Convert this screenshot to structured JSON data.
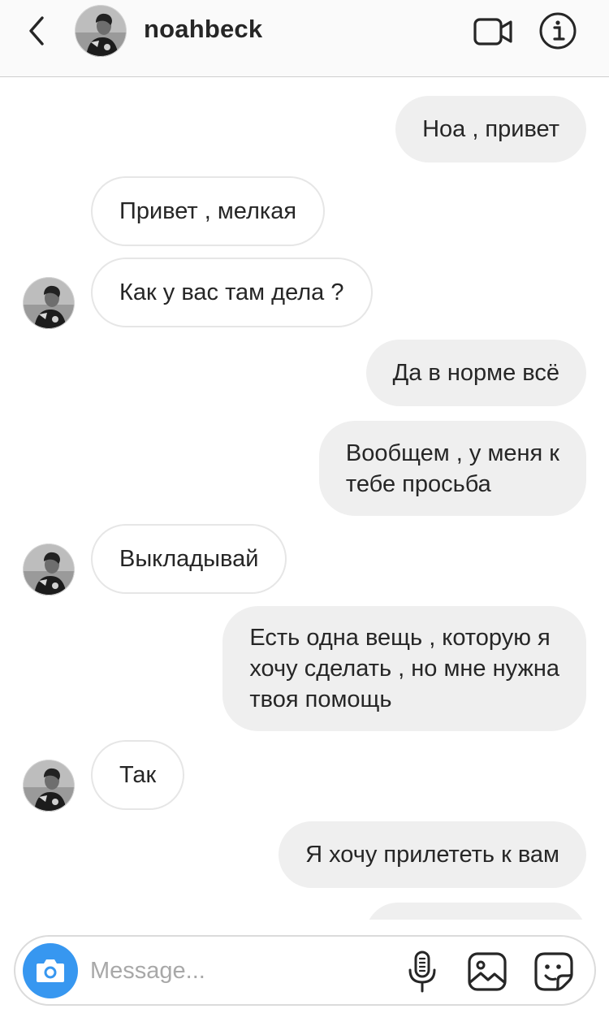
{
  "header": {
    "username": "noahbeck",
    "back_icon": "chevron-left-icon",
    "video_icon": "video-camera-icon",
    "info_icon": "info-icon"
  },
  "messages": [
    {
      "direction": "outgoing",
      "text": "Ноа , привет"
    },
    {
      "direction": "incoming",
      "text": "Привет , мелкая",
      "avatar": false
    },
    {
      "direction": "incoming",
      "text": "Как у вас там дела ?",
      "avatar": true
    },
    {
      "direction": "outgoing",
      "text": "Да в норме всё"
    },
    {
      "direction": "outgoing",
      "text": "Вообщем , у меня к\nтебе просьба"
    },
    {
      "direction": "incoming",
      "text": "Выкладывай",
      "avatar": true
    },
    {
      "direction": "outgoing",
      "text": "Есть одна вещь , которую я\nхочу сделать , но мне нужна\nтвоя помощь"
    },
    {
      "direction": "incoming",
      "text": "Так",
      "avatar": true
    },
    {
      "direction": "outgoing",
      "text": "Я хочу прилететь к вам"
    }
  ],
  "composer": {
    "placeholder": "Message...",
    "camera_icon": "camera-icon",
    "mic_icon": "microphone-icon",
    "gallery_icon": "image-gallery-icon",
    "sticker_icon": "sticker-icon"
  },
  "colors": {
    "outgoing_bubble": "#efefef",
    "incoming_border": "#e6e6e6",
    "camera_button": "#3797f0",
    "text": "#262626"
  }
}
